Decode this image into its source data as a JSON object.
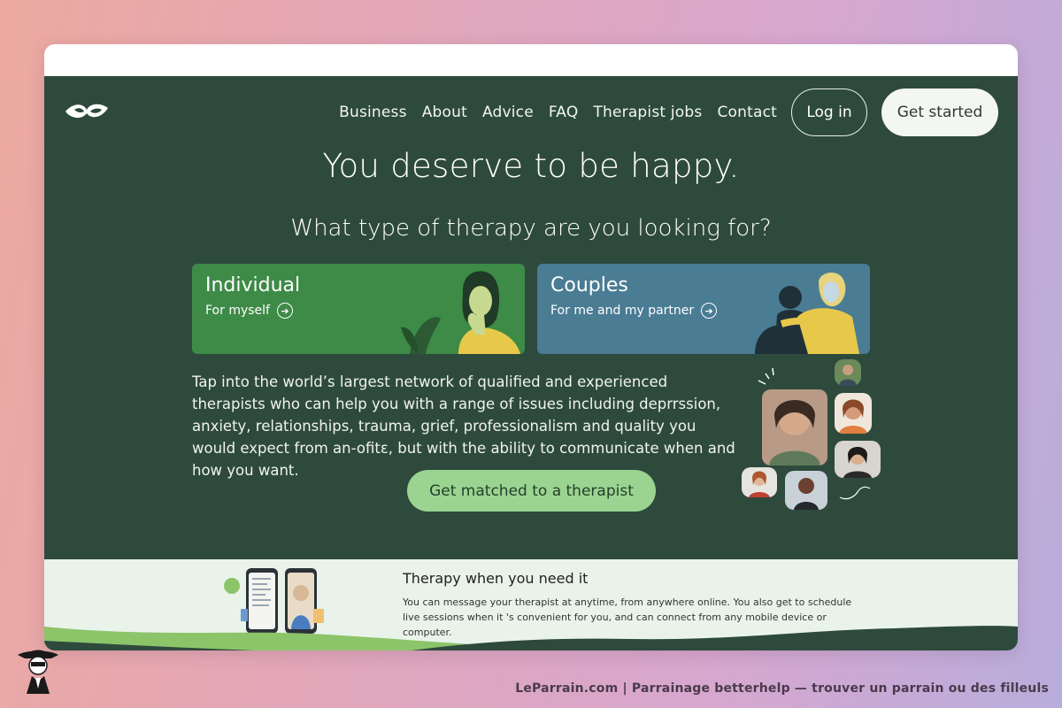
{
  "brand": {
    "logo_icon": "leaf-eye-logo-icon"
  },
  "nav": {
    "links": [
      "Business",
      "About",
      "Advice",
      "FAQ",
      "Therapist jobs",
      "Contact"
    ],
    "login_label": "Log in",
    "get_started_label": "Get started"
  },
  "hero": {
    "headline": "You deserve to be happy.",
    "question": "What type of therapy are you looking for?",
    "cards": [
      {
        "title": "Individual",
        "subtitle": "For myself",
        "color": "#3e8a47"
      },
      {
        "title": "Couples",
        "subtitle": "For me and my partner",
        "color": "#4a7c94"
      }
    ],
    "description": "Tap into the world’s largest network of qualified and experienced therapists who can help you with a range of issues including deprrssion, anxiety, relationships, trauma, grief,  professionalism and quality you would expect from an-ofitɛ, but with the ability to communicate when and how you want.",
    "cta_label": "Get matched to a therapist",
    "background_color": "#2e4a3d",
    "cta_color": "#9bd490"
  },
  "feature": {
    "title": "Therapy when you need it",
    "text": "You can message your therapist at anytime, from anywhere online. You also get to schedule live sessions when it 's convenient for you, and can connect from any mobile device or computer."
  },
  "caption": "LeParrain.com | Parrainage betterhelp — trouver un parrain ou des filleuls"
}
